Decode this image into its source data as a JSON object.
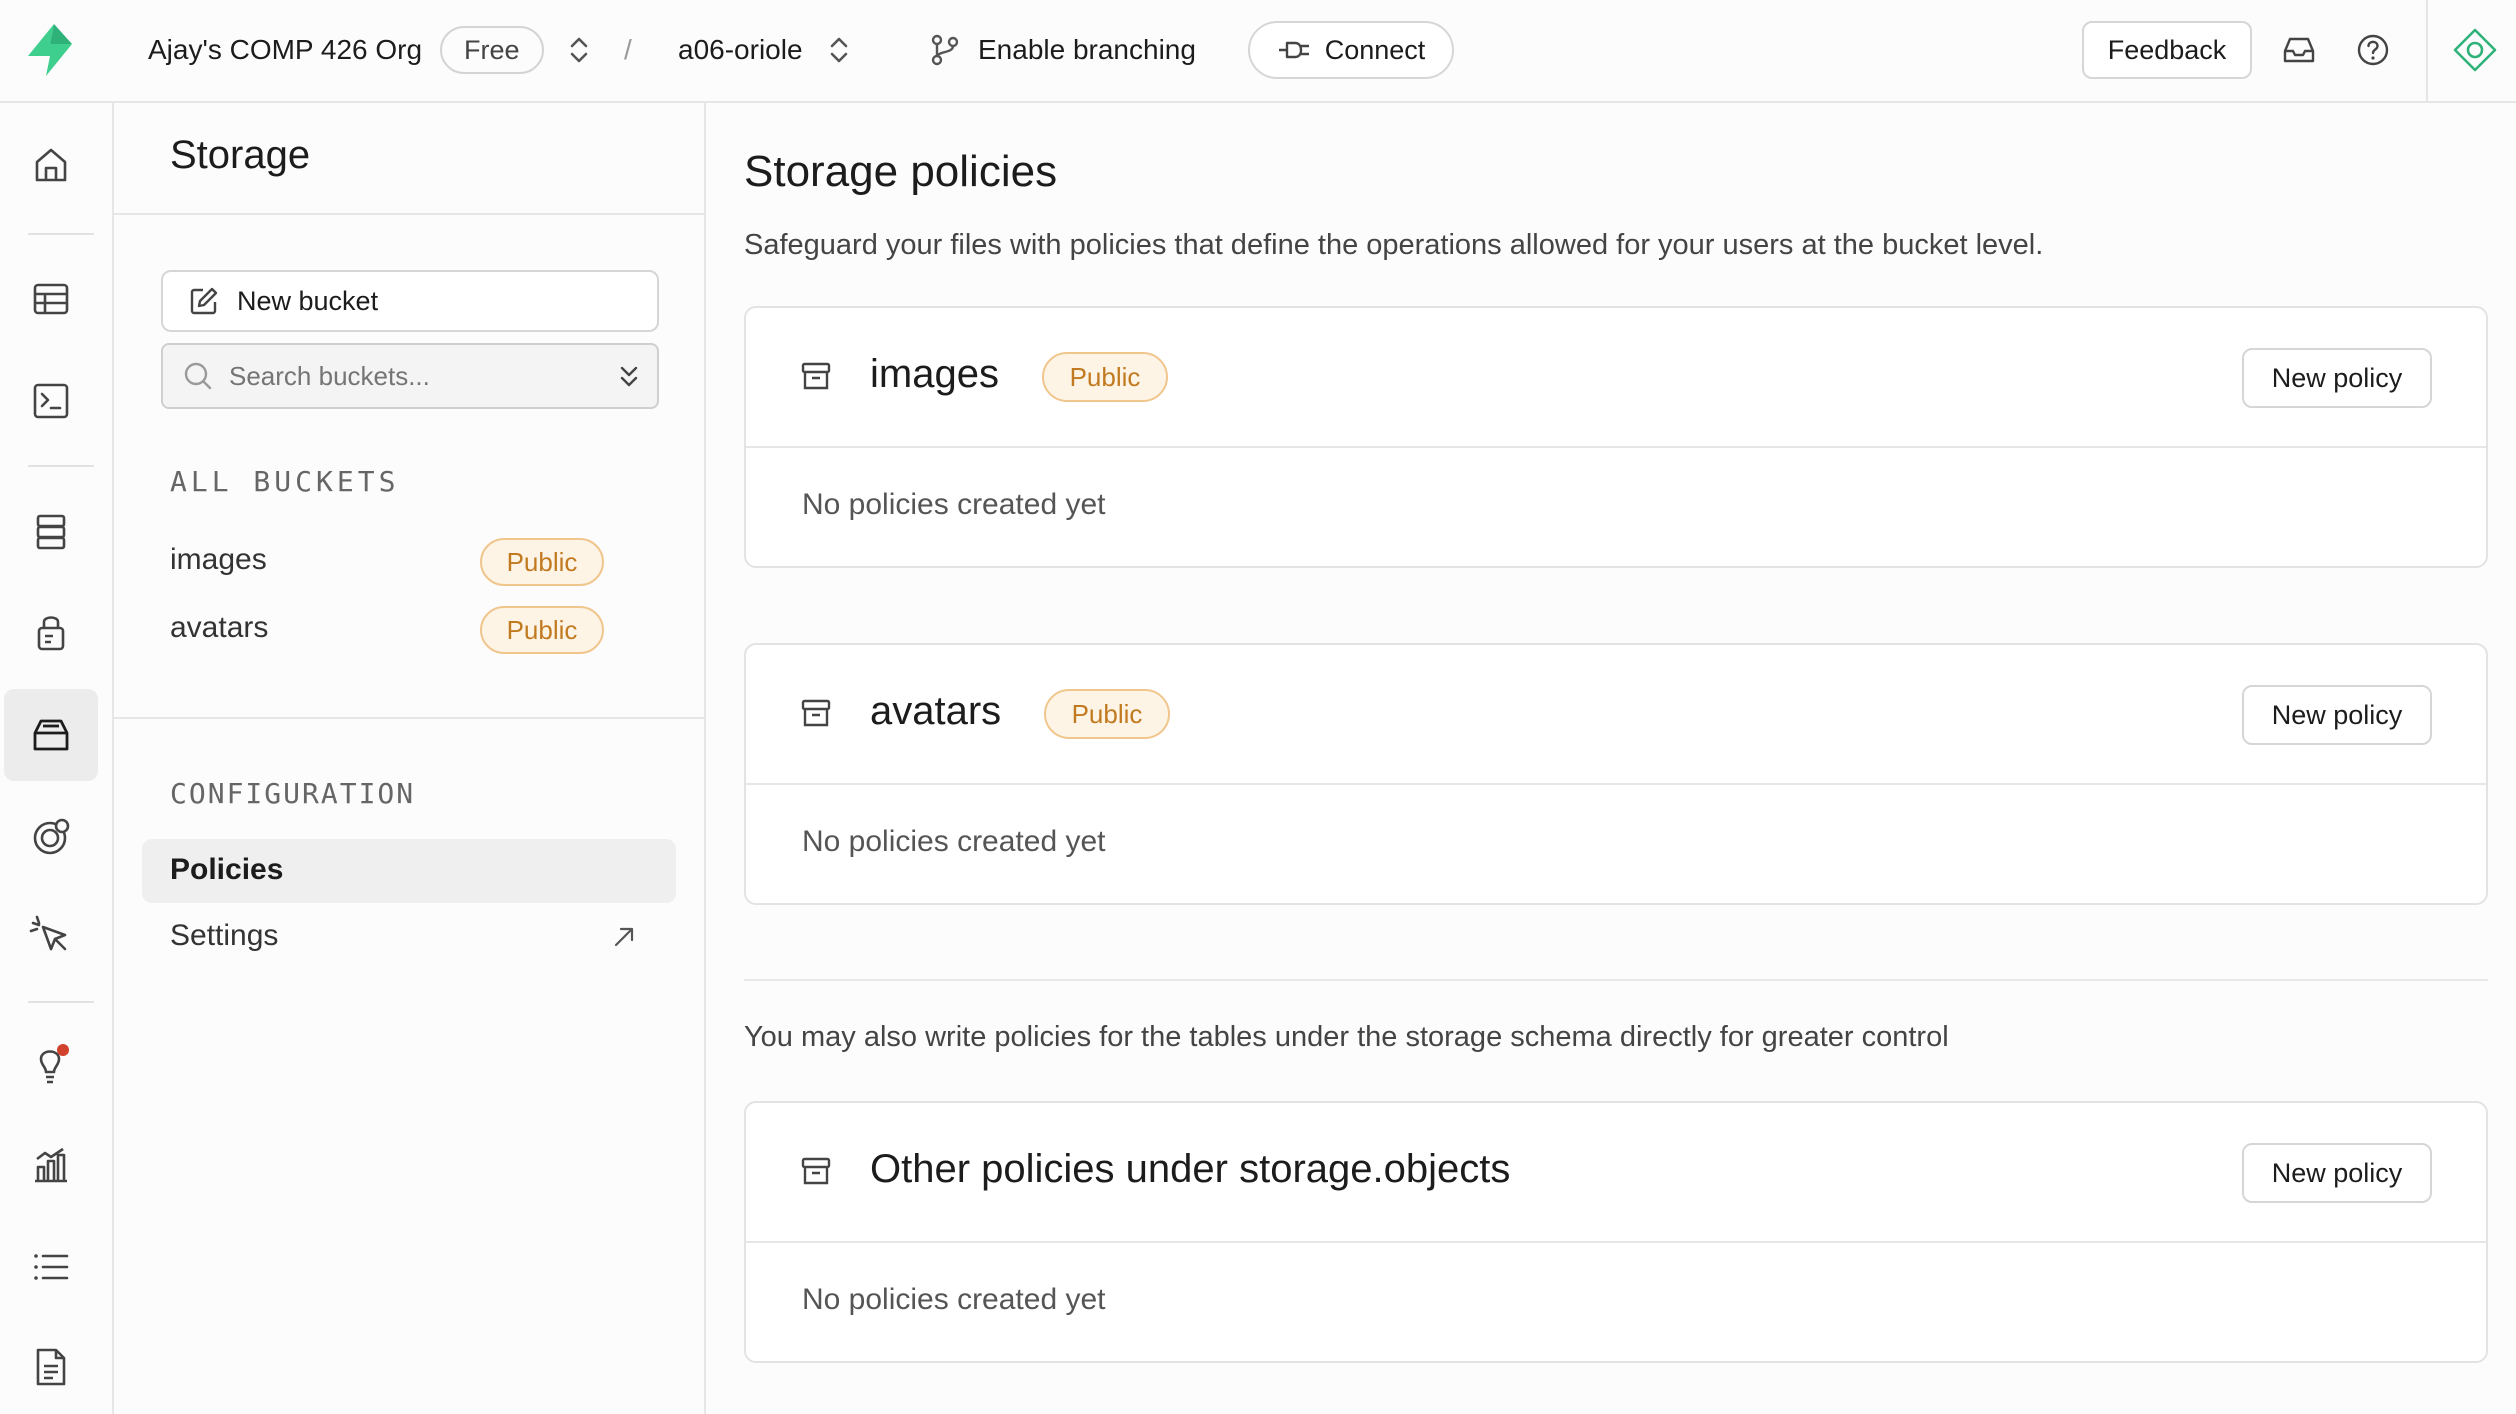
{
  "topbar": {
    "org_name": "Ajay's COMP 426 Org",
    "plan_badge": "Free",
    "separator": "/",
    "project_name": "a06-oriole",
    "branching_label": "Enable branching",
    "connect_label": "Connect",
    "feedback_label": "Feedback"
  },
  "sidebar": {
    "title": "Storage",
    "new_bucket_label": "New bucket",
    "search_placeholder": "Search buckets...",
    "all_buckets_heading": "ALL BUCKETS",
    "buckets": [
      {
        "name": "images",
        "badge": "Public"
      },
      {
        "name": "avatars",
        "badge": "Public"
      }
    ],
    "configuration_heading": "CONFIGURATION",
    "config_items": [
      {
        "label": "Policies",
        "active": true
      },
      {
        "label": "Settings",
        "active": false
      }
    ]
  },
  "main": {
    "title": "Storage policies",
    "subtitle": "Safeguard your files with policies that define the operations allowed for your users at the bucket level.",
    "cards": [
      {
        "title": "images",
        "badge": "Public",
        "button": "New policy",
        "empty": "No policies created yet"
      },
      {
        "title": "avatars",
        "badge": "Public",
        "button": "New policy",
        "empty": "No policies created yet"
      }
    ],
    "other_note": "You may also write policies for the tables under the storage schema directly for greater control",
    "other_card": {
      "title": "Other policies under storage.objects",
      "button": "New policy",
      "empty": "No policies created yet"
    }
  },
  "colors": {
    "brand": "#3ecf8e",
    "badge_text": "#c27a21",
    "badge_border": "#f0c68d",
    "notification_dot": "#d0422b"
  },
  "icons": {
    "left_nav": [
      "home-icon",
      "table-editor-icon",
      "sql-editor-icon",
      "database-icon",
      "authentication-icon",
      "storage-icon",
      "realtime-icon",
      "edge-functions-icon",
      "advisors-icon",
      "reports-icon",
      "logs-icon",
      "api-docs-icon"
    ]
  }
}
